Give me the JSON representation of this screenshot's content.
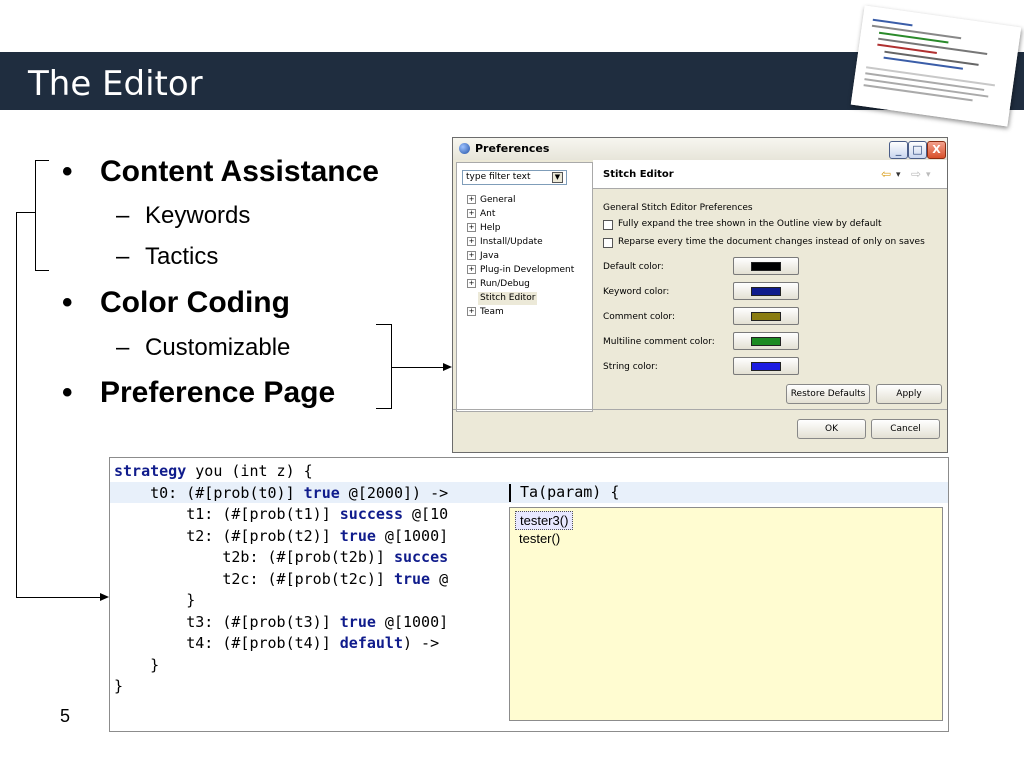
{
  "slide": {
    "title": "The Editor",
    "page_number": "5"
  },
  "bullets": [
    {
      "label": "Content Assistance",
      "bullet": "•",
      "subitems": [
        "Keywords",
        "Tactics"
      ]
    },
    {
      "label": "Color Coding",
      "bullet": "•",
      "subitems": [
        "Customizable"
      ]
    },
    {
      "label": "Preference Page",
      "bullet": "•",
      "subitems": []
    }
  ],
  "sub_marker": "–",
  "preferences": {
    "window_title": "Preferences",
    "window_buttons": {
      "minimize": "_",
      "maximize": "□",
      "close": "X"
    },
    "filter_placeholder": "type filter text",
    "tree_items": [
      {
        "label": "General",
        "expandable": true
      },
      {
        "label": "Ant",
        "expandable": true
      },
      {
        "label": "Help",
        "expandable": true
      },
      {
        "label": "Install/Update",
        "expandable": true
      },
      {
        "label": "Java",
        "expandable": true
      },
      {
        "label": "Plug-in Development",
        "expandable": true
      },
      {
        "label": "Run/Debug",
        "expandable": true
      },
      {
        "label": "Stitch Editor",
        "expandable": false,
        "selected": true
      },
      {
        "label": "Team",
        "expandable": true
      }
    ],
    "expander_glyph": "+",
    "page_title": "Stitch Editor",
    "nav": {
      "back": "⇦",
      "forward": "⇨",
      "menu": "▾"
    },
    "description": "General Stitch Editor Preferences",
    "checkboxes": [
      {
        "label": "Fully expand the tree shown in the Outline view by default",
        "checked": false
      },
      {
        "label": "Reparse every time the document changes instead of only on saves",
        "checked": false
      }
    ],
    "colors": [
      {
        "label": "Default color:",
        "value": "#000000"
      },
      {
        "label": "Keyword color:",
        "value": "#101c8c"
      },
      {
        "label": "Comment color:",
        "value": "#8a7c10"
      },
      {
        "label": "Multiline comment color:",
        "value": "#1c8a22"
      },
      {
        "label": "String color:",
        "value": "#1c1ce0"
      }
    ],
    "buttons": {
      "restore_defaults": "Restore Defaults",
      "apply": "Apply",
      "ok": "OK",
      "cancel": "Cancel"
    }
  },
  "editor": {
    "lines": [
      [
        {
          "t": "strategy",
          "k": true
        },
        {
          "t": " you (int z) {"
        }
      ],
      [
        {
          "t": "    t0: (#[prob(t0)] "
        },
        {
          "t": "true",
          "k": true
        },
        {
          "t": " @[2000]) ->"
        }
      ],
      [
        {
          "t": "        t1: (#[prob(t1)] "
        },
        {
          "t": "success",
          "k": true
        },
        {
          "t": " @[10"
        }
      ],
      [
        {
          "t": "        t2: (#[prob(t2)] "
        },
        {
          "t": "true",
          "k": true
        },
        {
          "t": " @[1000]"
        }
      ],
      [
        {
          "t": "            t2b: (#[prob(t2b)] "
        },
        {
          "t": "succes",
          "k": true
        }
      ],
      [
        {
          "t": "            t2c: (#[prob(t2c)] "
        },
        {
          "t": "true",
          "k": true
        },
        {
          "t": " @"
        }
      ],
      [
        {
          "t": "        }"
        }
      ],
      [
        {
          "t": "        t3: (#[prob(t3)] "
        },
        {
          "t": "true",
          "k": true
        },
        {
          "t": " @[1000]"
        }
      ],
      [
        {
          "t": "        t4: (#[prob(t4)] "
        },
        {
          "t": "default",
          "k": true
        },
        {
          "t": ") ->"
        }
      ],
      [
        {
          "t": "    }"
        }
      ],
      [
        {
          "t": "}"
        }
      ]
    ],
    "after_cursor": " Ta(param) {",
    "completions": [
      "tester3()",
      "tester()"
    ]
  }
}
